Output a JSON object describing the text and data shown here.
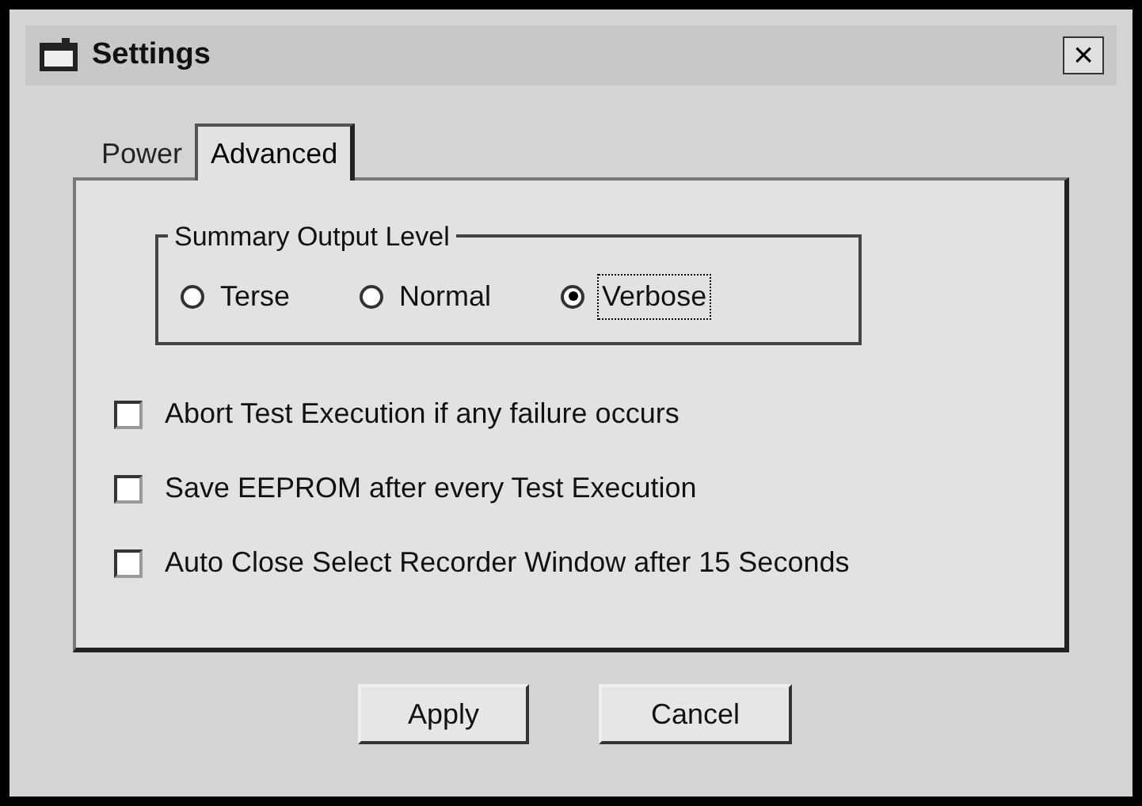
{
  "window": {
    "title": "Settings",
    "close": "×"
  },
  "tabs": [
    {
      "label": "Power",
      "selected": false
    },
    {
      "label": "Advanced",
      "selected": true
    }
  ],
  "group": {
    "title": "Summary Output Level",
    "options": [
      {
        "label": "Terse",
        "selected": false
      },
      {
        "label": "Normal",
        "selected": false
      },
      {
        "label": "Verbose",
        "selected": true
      }
    ]
  },
  "checkboxes": [
    {
      "label": "Abort Test Execution if any failure occurs",
      "checked": false
    },
    {
      "label": "Save EEPROM after every Test Execution",
      "checked": false
    },
    {
      "label": "Auto Close Select Recorder Window after 15 Seconds",
      "checked": false
    }
  ],
  "buttons": [
    "Apply",
    "Cancel"
  ]
}
